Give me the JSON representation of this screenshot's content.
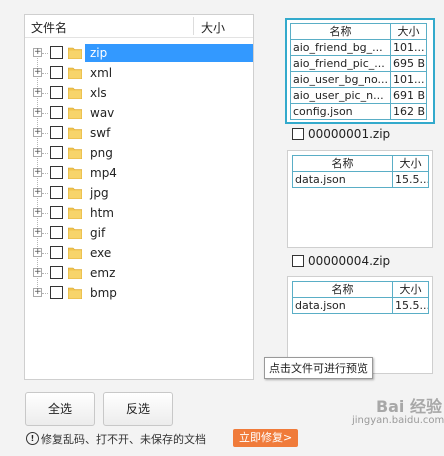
{
  "tree": {
    "header_name": "文件名",
    "header_size": "大小",
    "items": [
      {
        "label": "zip",
        "selected": true
      },
      {
        "label": "xml",
        "selected": false
      },
      {
        "label": "xls",
        "selected": false
      },
      {
        "label": "wav",
        "selected": false
      },
      {
        "label": "swf",
        "selected": false
      },
      {
        "label": "png",
        "selected": false
      },
      {
        "label": "mp4",
        "selected": false
      },
      {
        "label": "jpg",
        "selected": false
      },
      {
        "label": "htm",
        "selected": false
      },
      {
        "label": "gif",
        "selected": false
      },
      {
        "label": "exe",
        "selected": false
      },
      {
        "label": "emz",
        "selected": false
      },
      {
        "label": "bmp",
        "selected": false
      }
    ]
  },
  "preview": {
    "col_name": "名称",
    "col_size": "大小",
    "box1": {
      "rows": [
        {
          "name": "aio_friend_bg_...",
          "size": "101..."
        },
        {
          "name": "aio_friend_pic_...",
          "size": "695 B"
        },
        {
          "name": "aio_user_bg_no...",
          "size": "101..."
        },
        {
          "name": "aio_user_pic_n...",
          "size": "691 B"
        },
        {
          "name": "config.json",
          "size": "162 B"
        }
      ]
    },
    "zip1": {
      "label": "00000001.zip"
    },
    "box2": {
      "rows": [
        {
          "name": "data.json",
          "size": "15.5..."
        }
      ]
    },
    "zip2": {
      "label": "00000004.zip"
    },
    "box3": {
      "rows": [
        {
          "name": "data.json",
          "size": "15.5..."
        }
      ]
    }
  },
  "tooltip": "点击文件可进行预览",
  "buttons": {
    "select_all": "全选",
    "invert": "反选"
  },
  "footer": {
    "warning_icon": "!",
    "warning_text": "修复乱码、打不开、未保存的文档",
    "repair_label": "立即修复>"
  },
  "watermark": {
    "line1": "Bai 经验",
    "line2": "jingyan.baidu.com"
  },
  "colors": {
    "selection": "#3399ff",
    "highlight_border": "#33aacc",
    "repair": "#f07b3a",
    "folder": "#f2c44e"
  }
}
